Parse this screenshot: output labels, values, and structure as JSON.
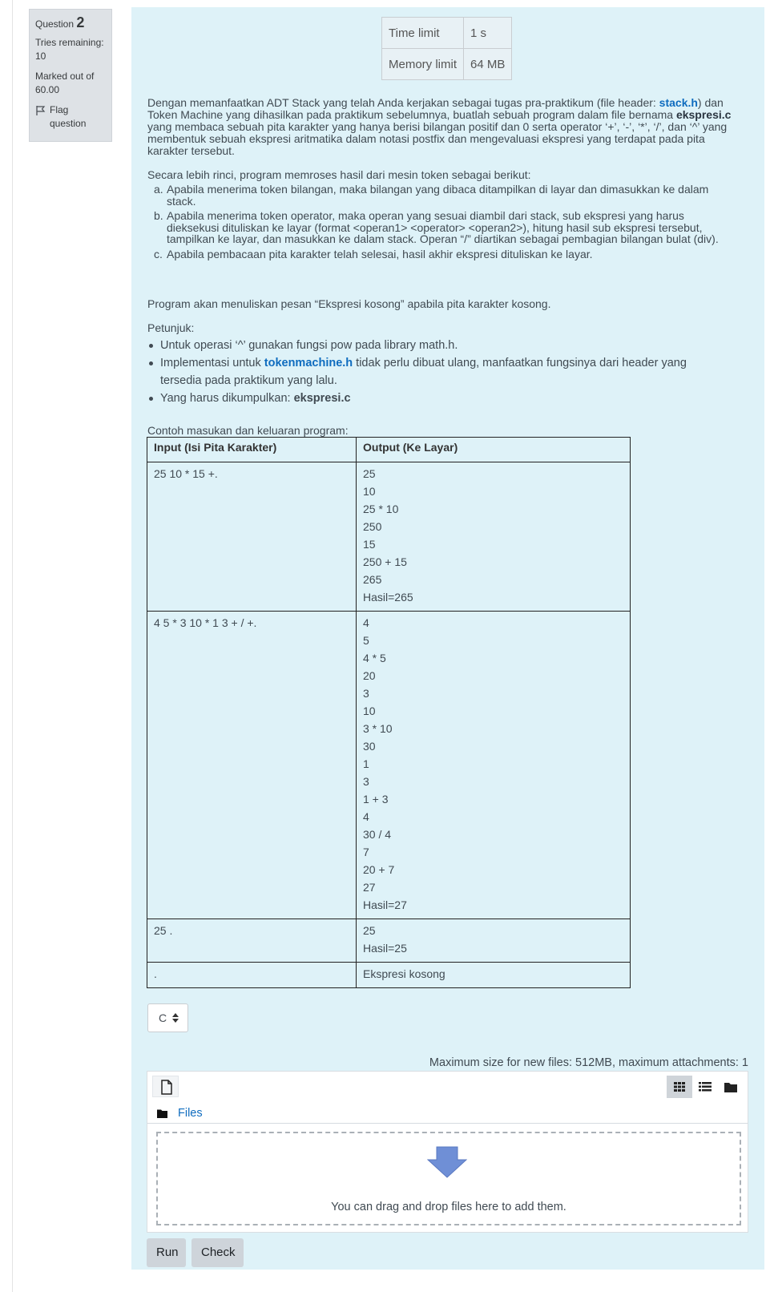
{
  "question_info": {
    "question_label": "Question",
    "question_number": "2",
    "tries_label": "Tries remaining:",
    "tries_value": "10",
    "marked_label": "Marked out of",
    "marked_value": "60.00",
    "flag_label": "Flag",
    "flag_label_2": "question"
  },
  "limits": [
    {
      "label": "Time limit",
      "value": "1 s"
    },
    {
      "label": "Memory limit",
      "value": "64 MB"
    }
  ],
  "description": {
    "p1_a": "Dengan memanfaatkan ADT Stack yang telah Anda kerjakan sebagai tugas pra-praktikum (file header: ",
    "p1_link1": "stack.h",
    "p1_b": ") dan Token Machine yang dihasilkan pada praktikum sebelumnya, buatlah sebuah program dalam file bernama ",
    "p1_bold": "ekspresi.c",
    "p1_c": " yang membaca sebuah pita karakter yang hanya berisi bilangan positif dan 0 serta operator ‘+’, ‘-’, ‘*’, ‘/’, dan ‘^’ yang membentuk sebuah ekspresi aritmatika dalam notasi postfix dan mengevaluasi ekspresi yang terdapat pada pita karakter tersebut.",
    "p2": "Secara lebih rinci, program memroses hasil dari mesin token sebagai berikut:",
    "steps": [
      {
        "marker": "a.",
        "text": "Apabila menerima token bilangan, maka bilangan yang dibaca ditampilkan di layar dan dimasukkan ke dalam stack."
      },
      {
        "marker": "b.",
        "text": "Apabila menerima token operator, maka operan yang sesuai diambil dari stack, sub ekspresi yang harus dieksekusi dituliskan ke layar (format <operan1> <operator> <operan2>), hitung hasil sub ekspresi tersebut, tampilkan ke layar, dan masukkan ke dalam stack. Operan “/” diartikan sebagai pembagian bilangan bulat (div)."
      },
      {
        "marker": "c.",
        "text": "Apabila pembacaan pita karakter telah selesai, hasil akhir ekspresi dituliskan ke layar."
      }
    ],
    "p3": "Program akan menuliskan pesan “Ekspresi kosong” apabila pita karakter kosong.",
    "hint_label": "Petunjuk:",
    "hint1": "Untuk operasi ‘^’ gunakan fungsi pow pada library math.h.",
    "hint2_a": "Implementasi untuk ",
    "hint2_link": "tokenmachine.h",
    "hint2_b": " tidak perlu dibuat ulang, manfaatkan fungsinya dari header yang tersedia pada praktikum yang lalu.",
    "hint3_a": "Yang harus dikumpulkan: ",
    "hint3_bold": "ekspresi.c",
    "example_label": "Contoh masukan dan keluaran program:"
  },
  "io_table": {
    "headers": [
      "Input (Isi Pita Karakter)",
      "Output (Ke Layar)"
    ],
    "rows": [
      {
        "input": "25 10 * 15 +.",
        "output": "25\n10\n25 * 10\n250\n15\n250 + 15\n265\nHasil=265"
      },
      {
        "input": "4 5 * 3 10 * 1 3 + / +.",
        "output": "4\n5\n4 * 5\n20\n3\n10\n3 * 10\n30\n1\n3\n1 + 3\n4\n30 / 4\n7\n20 + 7\n27\nHasil=27"
      },
      {
        "input": "25 .",
        "output": "25\nHasil=25"
      },
      {
        "input": ".",
        "output": "Ekspresi kosong"
      }
    ]
  },
  "language_select": {
    "value": "C"
  },
  "filemanager": {
    "max_size_text": "Maximum size for new files: 512MB, maximum attachments: 1",
    "folder_label": "Files",
    "drop_text": "You can drag and drop files here to add them."
  },
  "buttons": {
    "run": "Run",
    "check": "Check"
  },
  "colors": {
    "panel_bg": "#def2f8",
    "info_bg": "#dee2e6",
    "link": "#0f6cbf",
    "button": "#ced4da",
    "drop_arrow": "#6f8fd6"
  }
}
